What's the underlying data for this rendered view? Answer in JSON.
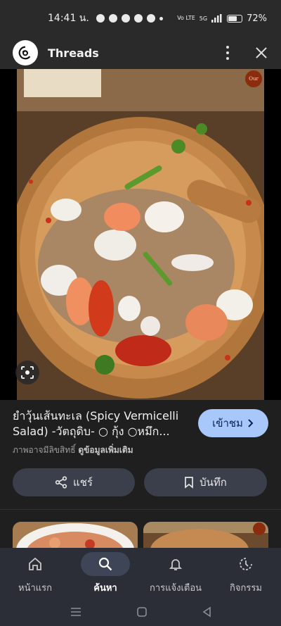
{
  "status": {
    "time": "14:41 น.",
    "network": "Vo LTE",
    "signal_label": "5G",
    "battery": "72%",
    "battery_level": 0.72
  },
  "header": {
    "app_name": "Threads"
  },
  "image": {
    "badge": "Our"
  },
  "result": {
    "caption": "ยำวุ้นเส้นทะเล (Spicy Vermicelli Salad) -วัตถุดิบ- ○ กุ้ง ○หมึก...",
    "visit_label": "เข้าชม",
    "copyright_text": "ภาพอาจมีลิขสิทธิ์",
    "more_info_link": "ดูข้อมูลเพิ่มเติม",
    "share_label": "แชร์",
    "save_label": "บันทึก"
  },
  "nav": {
    "items": [
      {
        "label": "หน้าแรก",
        "icon": "home-icon"
      },
      {
        "label": "ค้นหา",
        "icon": "search-icon",
        "active": true
      },
      {
        "label": "การแจ้งเตือน",
        "icon": "bell-icon"
      },
      {
        "label": "กิจกรรม",
        "icon": "activity-icon"
      }
    ]
  },
  "colors": {
    "accent": "#a8c7fa",
    "background": "#1f1f1f",
    "nav_bg": "#2b2e36"
  }
}
